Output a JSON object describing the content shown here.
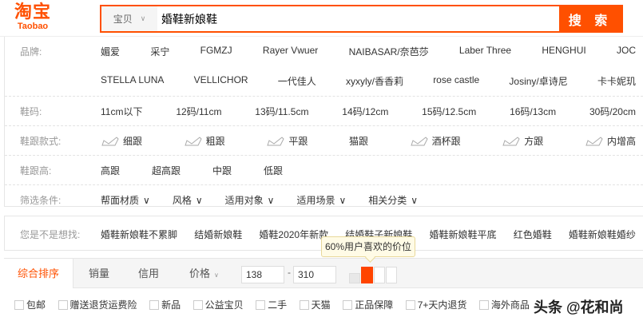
{
  "logo": {
    "cn": "淘宝",
    "en": "Taobao"
  },
  "search": {
    "category": "宝贝",
    "query": "婚鞋新娘鞋",
    "button": "搜 索"
  },
  "filters": {
    "brand": {
      "label": "品牌:",
      "row1": [
        "媚爱",
        "采宁",
        "FGMZJ",
        "Rayer Vwuer",
        "NAIBASAR/奈芭莎",
        "Laber Three",
        "HENGHUI",
        "JOC"
      ],
      "row2": [
        "STELLA LUNA",
        "VELLICHOR",
        "一代佳人",
        "xyxyly/香香莉",
        "rose castle",
        "Josiny/卓诗尼",
        "卡卡妮玑"
      ]
    },
    "size": {
      "label": "鞋码:",
      "items": [
        "11cm以下",
        "12码/11cm",
        "13码/11.5cm",
        "14码/12cm",
        "15码/12.5cm",
        "16码/13cm",
        "30码/20cm"
      ]
    },
    "heel_style": {
      "label": "鞋跟款式:",
      "items": [
        "细跟",
        "粗跟",
        "平跟",
        "猫跟",
        "酒杯跟",
        "方跟",
        "内增高"
      ]
    },
    "heel_height": {
      "label": "鞋跟高:",
      "items": [
        "高跟",
        "超高跟",
        "中跟",
        "低跟"
      ]
    },
    "conditions": {
      "label": "筛选条件:",
      "items": [
        "帮面材质",
        "风格",
        "适用对象",
        "适用场景",
        "相关分类"
      ]
    }
  },
  "suggestions": {
    "label": "您是不是想找:",
    "items": [
      "婚鞋新娘鞋不累脚",
      "结婚新娘鞋",
      "婚鞋2020年新款",
      "结婚鞋子新娘鞋",
      "婚鞋新娘鞋平底",
      "红色婚鞋",
      "婚鞋新娘鞋婚纱"
    ]
  },
  "sort": {
    "tabs": [
      "综合排序",
      "销量",
      "信用",
      "价格"
    ],
    "price_min": "138",
    "price_max": "310",
    "price_dash": "-",
    "tooltip": "60%用户喜欢的价位",
    "accent": "#ff5000"
  },
  "checkboxes": [
    "包邮",
    "赠送退货运费险",
    "新品",
    "公益宝贝",
    "二手",
    "天猫",
    "正品保障",
    "7+天内退货",
    "海外商品"
  ],
  "watermark": "头条 @花和尚"
}
